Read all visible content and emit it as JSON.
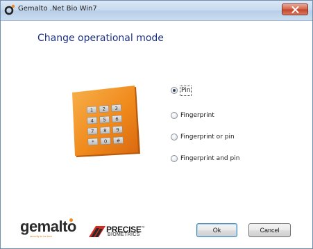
{
  "window": {
    "title": "Gemalto .Net Bio Win7",
    "close_icon": "close-icon",
    "app_icon": "gemalto-app-icon"
  },
  "main": {
    "heading": "Change operational mode",
    "image": "pin-keypad-illustration",
    "keypad_keys": [
      "1",
      "2",
      "3",
      "4",
      "5",
      "6",
      "7",
      "8",
      "9",
      "*",
      "0",
      "#"
    ]
  },
  "options": {
    "selected": "Pin",
    "items": [
      {
        "label": "Pin",
        "selected": true
      },
      {
        "label": "Fingerprint",
        "selected": false
      },
      {
        "label": "Fingerprint or pin",
        "selected": false
      },
      {
        "label": "Fingerprint and pin",
        "selected": false
      }
    ]
  },
  "footer": {
    "logo_gemalto": "gemalto",
    "logo_gemalto_tagline": "security to be free",
    "logo_precise_line1": "PRECISE",
    "logo_precise_line2": "BIOMETRICS",
    "ok_label": "Ok",
    "cancel_label": "Cancel"
  },
  "colors": {
    "heading": "#1e3287",
    "keypad_orange": "#f08a1c",
    "gemalto_dot": "#f08a1c",
    "close_button": "#c1442b"
  }
}
